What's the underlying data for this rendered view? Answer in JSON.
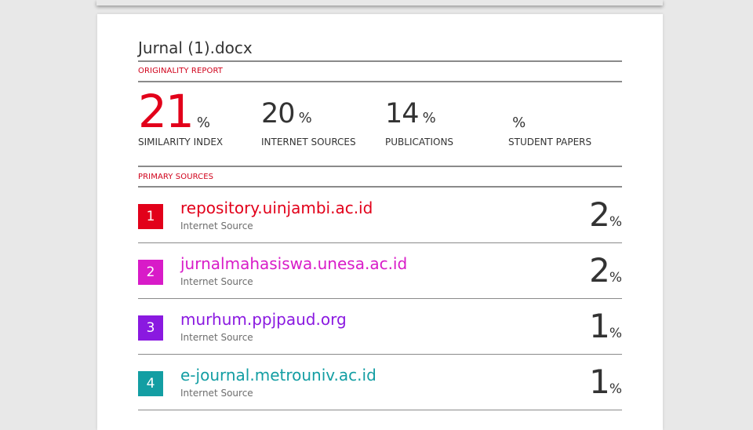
{
  "document": {
    "title": "Jurnal (1).docx"
  },
  "originality_report": {
    "label": "ORIGINALITY REPORT",
    "stats": [
      {
        "value": "21",
        "unit": "%",
        "caption": "SIMILARITY INDEX"
      },
      {
        "value": "20",
        "unit": "%",
        "caption": "INTERNET SOURCES"
      },
      {
        "value": "14",
        "unit": "%",
        "caption": "PUBLICATIONS"
      },
      {
        "value": "",
        "unit": "%",
        "caption": "STUDENT PAPERS"
      }
    ]
  },
  "primary_sources": {
    "label": "PRIMARY SOURCES",
    "items": [
      {
        "num": "1",
        "name": "repository.uinjambi.ac.id",
        "type": "Internet Source",
        "value": "2",
        "unit": "%",
        "color": "#e2001a"
      },
      {
        "num": "2",
        "name": "jurnalmahasiswa.unesa.ac.id",
        "type": "Internet Source",
        "value": "2",
        "unit": "%",
        "color": "#d81bc8"
      },
      {
        "num": "3",
        "name": "murhum.ppjpaud.org",
        "type": "Internet Source",
        "value": "1",
        "unit": "%",
        "color": "#8a19e0"
      },
      {
        "num": "4",
        "name": "e-journal.metrouniv.ac.id",
        "type": "Internet Source",
        "value": "1",
        "unit": "%",
        "color": "#139ea3"
      }
    ]
  }
}
